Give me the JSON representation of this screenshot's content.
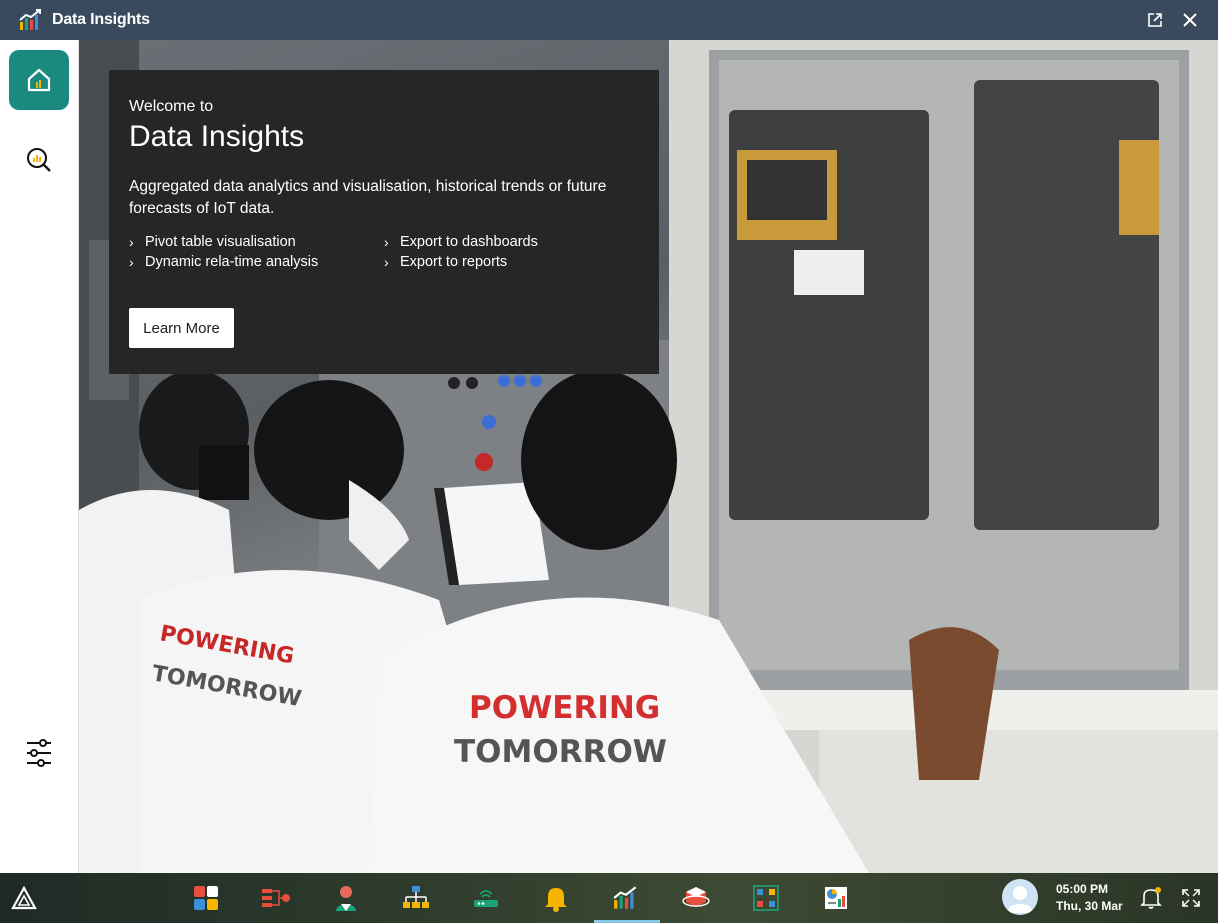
{
  "window": {
    "title": "Data Insights"
  },
  "card": {
    "welcome": "Welcome to",
    "title": "Data Insights",
    "description": "Aggregated data analytics and visualisation, historical trends or future forecasts of IoT data.",
    "features": [
      "Pivot table visualisation",
      "Export to dashboards",
      "Dynamic rela-time analysis",
      "Export to reports"
    ],
    "button": "Learn More"
  },
  "hero": {
    "shirt_text_1": "POWERING",
    "shirt_text_2": "TOMORROW"
  },
  "taskbar": {
    "time": "05:00 PM",
    "date": "Thu, 30 Mar",
    "apps": [
      "dashboard-tiles-icon",
      "flow-icon",
      "user-icon",
      "hierarchy-icon",
      "router-icon",
      "bell-icon",
      "data-insights-icon",
      "cube-icon",
      "network-icon",
      "report-icon"
    ]
  },
  "colors": {
    "titlebar": "#3a4a5e",
    "accent": "#1a8a7f",
    "card": "#262626"
  }
}
